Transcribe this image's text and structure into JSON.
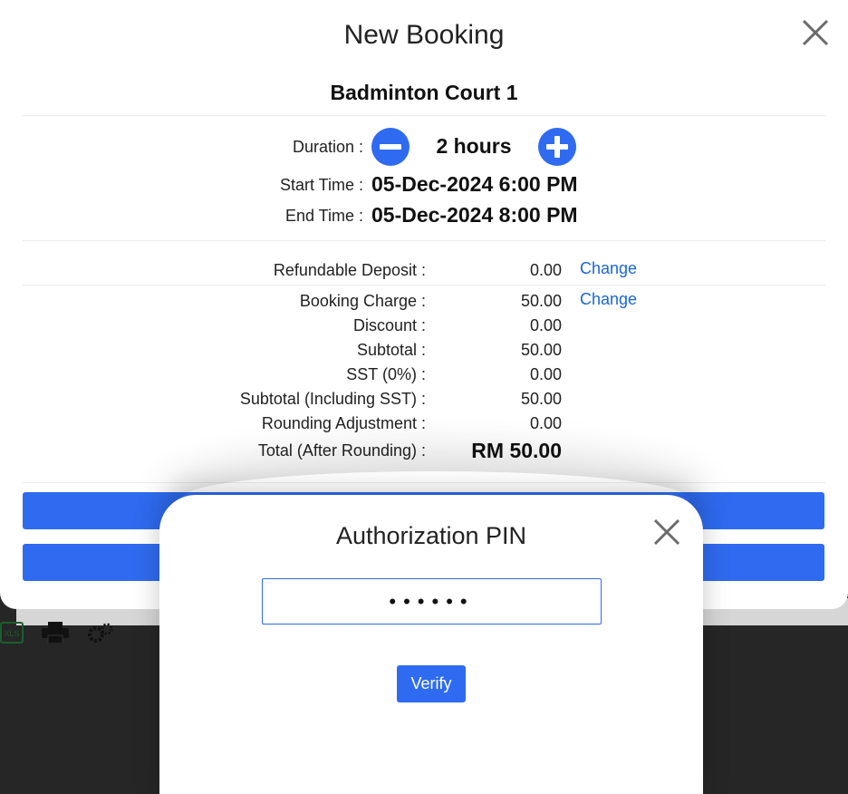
{
  "booking_modal": {
    "title": "New Booking",
    "court_name": "Badminton Court 1",
    "duration_label": "Duration :",
    "duration_value": "2 hours",
    "start_label": "Start Time :",
    "start_value": "05-Dec-2024 6:00 PM",
    "end_label": "End Time :",
    "end_value": "05-Dec-2024 8:00 PM",
    "change_label": "Change",
    "deposit": {
      "label": "Refundable Deposit :",
      "value": "0.00"
    },
    "charges": [
      {
        "label": "Booking Charge :",
        "value": "50.00"
      },
      {
        "label": "Discount :",
        "value": "0.00"
      },
      {
        "label": "Subtotal :",
        "value": "50.00"
      },
      {
        "label": "SST (0%) :",
        "value": "0.00"
      },
      {
        "label": "Subtotal (Including SST) :",
        "value": "50.00"
      },
      {
        "label": "Rounding Adjustment :",
        "value": "0.00"
      }
    ],
    "total": {
      "label": "Total (After Rounding) :",
      "value": "RM 50.00"
    }
  },
  "pin_modal": {
    "title": "Authorization PIN",
    "pin_value": "••••••",
    "verify_label": "Verify"
  },
  "toolbar": {
    "icons": [
      "xls-export-icon",
      "printer-icon",
      "settings-gear-icon"
    ]
  },
  "colors": {
    "accent": "#2f6bf0",
    "link": "#1a66d8",
    "backdrop": "#262626"
  }
}
